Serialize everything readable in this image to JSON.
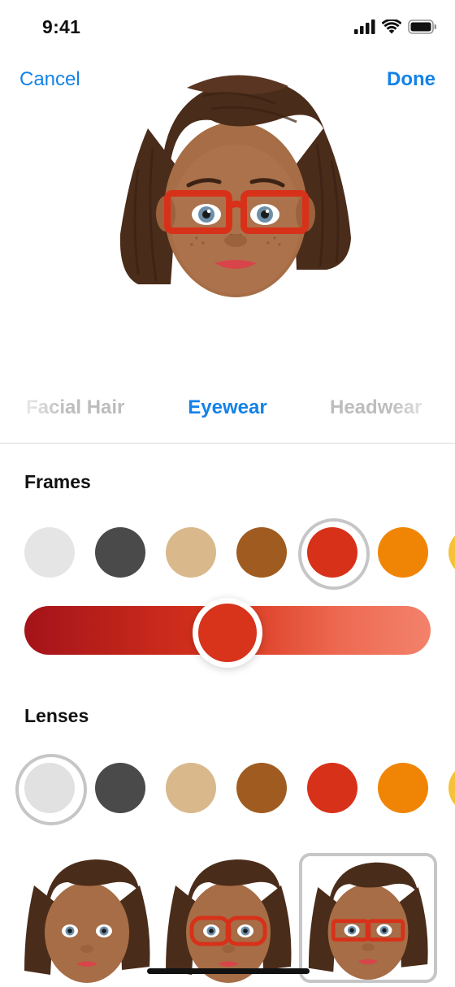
{
  "status_bar": {
    "time": "9:41"
  },
  "nav": {
    "cancel": "Cancel",
    "done": "Done"
  },
  "categories": {
    "left": "Facial Hair",
    "selected": "Eyewear",
    "right": "Headwear"
  },
  "frames": {
    "title": "Frames",
    "swatches": [
      "#e5e5e5",
      "#4a4a4a",
      "#d9b88b",
      "#a05c20",
      "#d8311a",
      "#f08505",
      "#f5c23a"
    ],
    "selected_index": 4,
    "shade_level": 0.5,
    "slider_gradient": [
      "#a4131a",
      "#d8331b",
      "#f3826b"
    ]
  },
  "lenses": {
    "title": "Lenses",
    "swatches": [
      "#e1e1e1",
      "#4a4a4a",
      "#d9b88b",
      "#a05c20",
      "#d8311a",
      "#f08505",
      "#f5c23a"
    ],
    "selected_index": 0
  },
  "styles": {
    "items": [
      "no-glasses",
      "round-red-frames",
      "rectangular-red-frames"
    ],
    "selected_index": 2
  },
  "colors": {
    "accent": "#1482e8",
    "inactive": "#bdbdbd",
    "skin": "#a66d46",
    "hair": "#4a2c1a"
  }
}
